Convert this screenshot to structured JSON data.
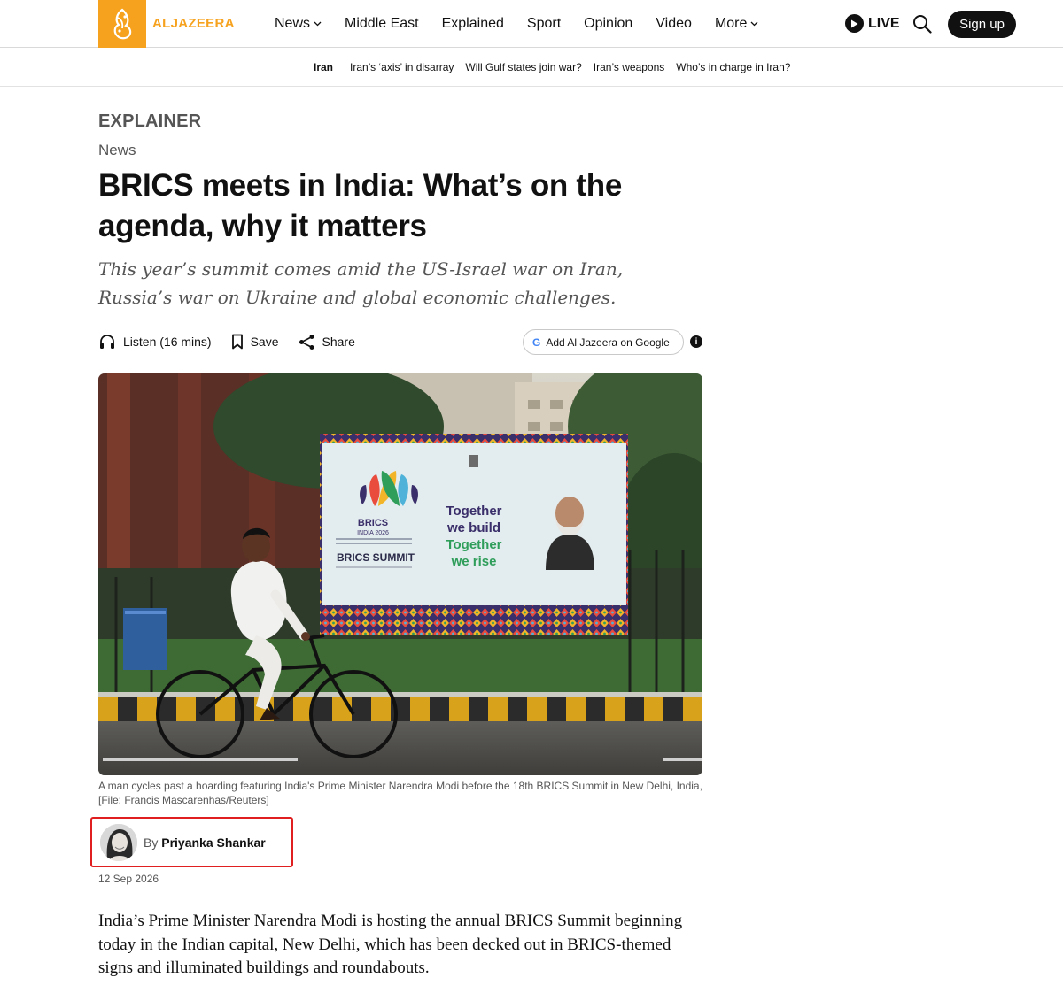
{
  "brand": {
    "name": "ALJAZEERA",
    "accent": "#f6a21e"
  },
  "nav": {
    "items": [
      {
        "label": "News",
        "dropdown": true
      },
      {
        "label": "Middle East",
        "dropdown": false
      },
      {
        "label": "Explained",
        "dropdown": false
      },
      {
        "label": "Sport",
        "dropdown": false
      },
      {
        "label": "Opinion",
        "dropdown": false
      },
      {
        "label": "Video",
        "dropdown": false
      },
      {
        "label": "More",
        "dropdown": true
      }
    ],
    "live_label": "LIVE",
    "signup_label": "Sign up"
  },
  "subnav": {
    "topic": "Iran",
    "links": [
      "Iran’s ‘axis’ in disarray",
      "Will Gulf states join war?",
      "Iran’s weapons",
      "Who’s in charge in Iran?"
    ]
  },
  "article": {
    "kicker": "EXPLAINER",
    "section": "News",
    "headline": "BRICS meets in India: What’s on the agenda, why it matters",
    "dek": "This year’s summit comes amid the US-Israel war on Iran, Russia’s war on Ukraine and global economic challenges.",
    "actions": {
      "listen": "Listen (16 mins)",
      "save": "Save",
      "share": "Share"
    },
    "google_button": "Add Al Jazeera on Google",
    "photo": {
      "sign_brand": "BRICS",
      "sign_sub": "INDIA 2026",
      "sign_summit": "BRICS SUMMIT",
      "sign_slogan": [
        "Together",
        "we build",
        "Together",
        "we rise"
      ]
    },
    "caption": "A man cycles past a hoarding featuring India's Prime Minister Narendra Modi before the 18th BRICS Summit in New Delhi, India, [File: Francis Mascarenhas/Reuters]",
    "byline_prefix": "By",
    "author": "Priyanka Shankar",
    "date": "12 Sep 2026",
    "body": "India’s Prime Minister Narendra Modi is hosting the annual BRICS Summit beginning today in the Indian capital, New Delhi, which has been decked out in BRICS-themed signs and illuminated buildings and roundabouts."
  },
  "colors": {
    "highlight_box": "#e02020",
    "text_muted": "#555555"
  }
}
